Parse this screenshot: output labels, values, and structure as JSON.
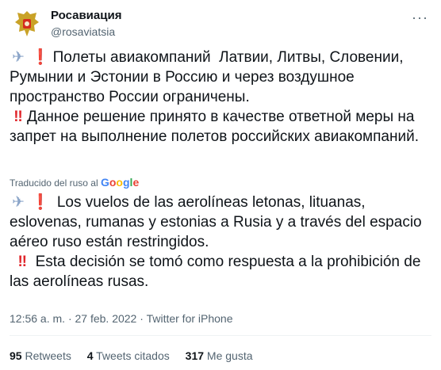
{
  "account": {
    "display_name": "Росавиация",
    "handle": "@rosaviatsia"
  },
  "tweet": {
    "ru_para1": "Полеты авиакомпаний  Латвии, Литвы, Словении, Румынии и Эстонии в Россию и через воздушное пространство России ограничены.",
    "ru_para2": "Данное решение принято в качестве ответной меры на запрет на выполнение полетов российских авиакомпаний.",
    "translated_label": "Traducido del ruso al",
    "translated_brand": "Google",
    "es_para1": "Los vuelos de las aerolíneas letonas, lituanas, eslovenas, rumanas y estonias a Rusia y a través del espacio aéreo ruso están restringidos.",
    "es_para2": "Esta decisión se tomó como respuesta a la prohibición de las aerolíneas rusas."
  },
  "meta": {
    "time": "12:56 a. m.",
    "date": "27 feb. 2022",
    "source": "Twitter for iPhone"
  },
  "stats": {
    "retweets_count": "95",
    "retweets_label": "Retweets",
    "quotes_count": "4",
    "quotes_label": "Tweets citados",
    "likes_count": "317",
    "likes_label": "Me gusta"
  },
  "icons": {
    "plane": "airplane-emoji",
    "exclamation": "exclamation-emoji",
    "double_exclamation": "double-exclamation-emoji"
  }
}
